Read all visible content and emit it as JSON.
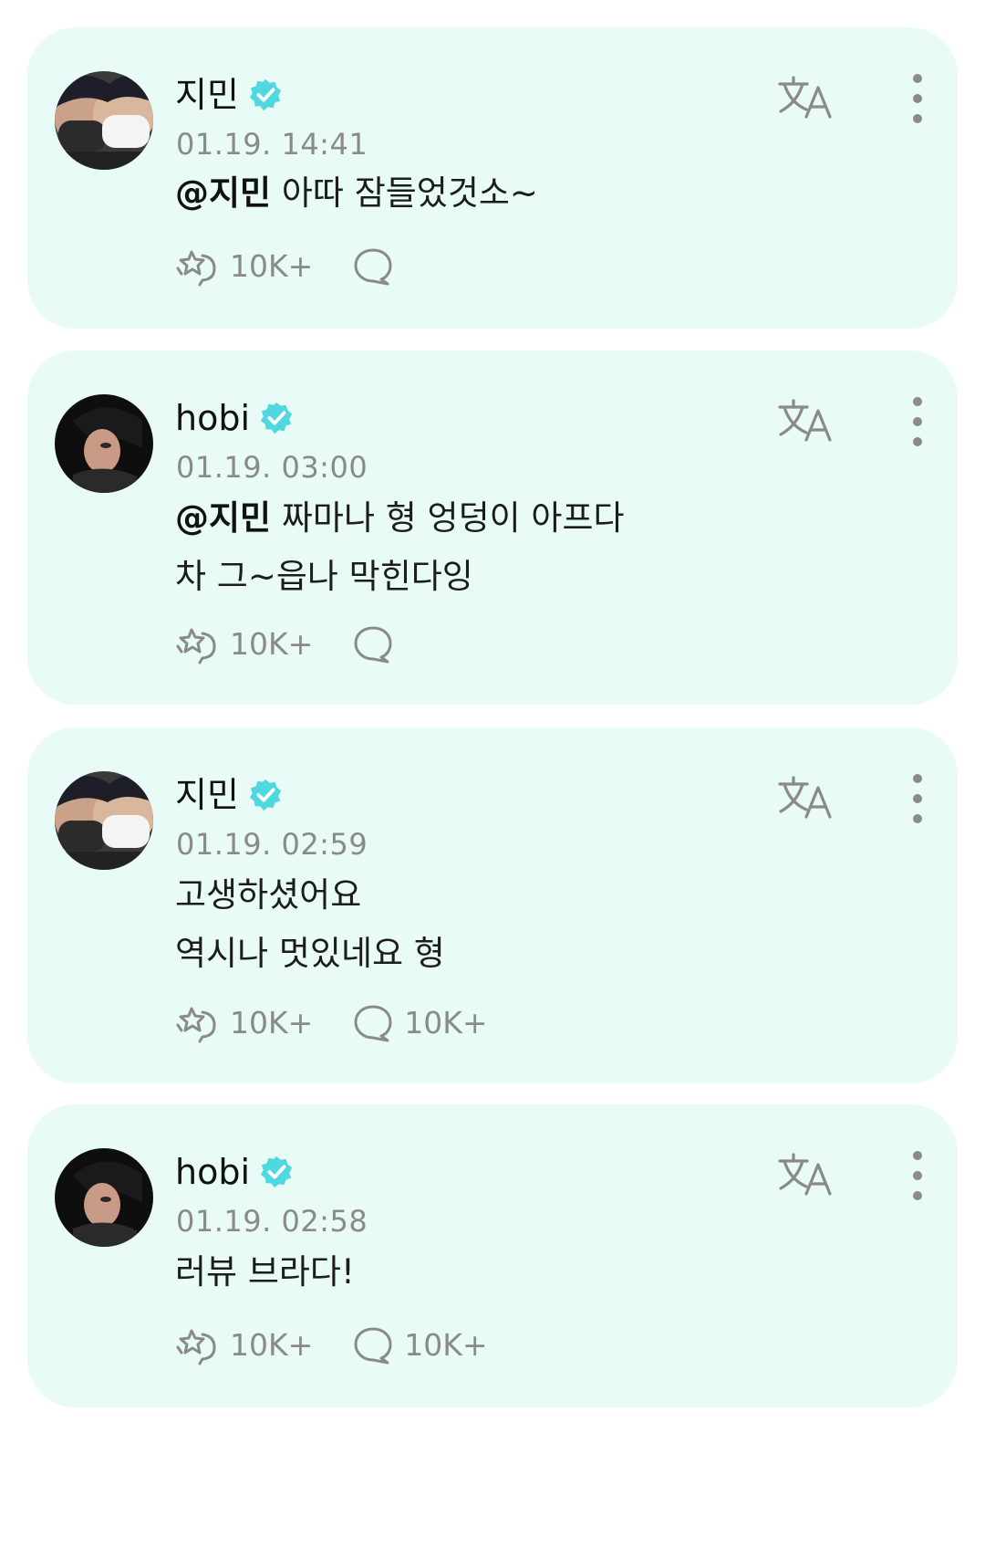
{
  "feed": {
    "posts": [
      {
        "author": "지민",
        "avatar_icon": "avatar-masked-duo-icon",
        "timestamp": "01.19. 14:41",
        "mention": "@지민",
        "lines": [
          "아따 잠들었것소~"
        ],
        "likes": "10K+",
        "comments": ""
      },
      {
        "author": "hobi",
        "avatar_icon": "avatar-hobi-icon",
        "timestamp": "01.19. 03:00",
        "mention": "@지민",
        "lines": [
          "짜마나 형 엉덩이 아프다",
          "차 그~읍나 막힌다잉"
        ],
        "likes": "10K+",
        "comments": ""
      },
      {
        "author": "지민",
        "avatar_icon": "avatar-masked-duo-icon",
        "timestamp": "01.19. 02:59",
        "mention": "",
        "lines": [
          "고생하셨어요",
          "역시나 멋있네요 형"
        ],
        "likes": "10K+",
        "comments": "10K+"
      },
      {
        "author": "hobi",
        "avatar_icon": "avatar-hobi-icon",
        "timestamp": "01.19. 02:58",
        "mention": "",
        "lines": [
          "러뷰 브라다!"
        ],
        "likes": "10K+",
        "comments": "10K+"
      }
    ]
  },
  "colors": {
    "card_background": "#e8fbf6",
    "verified_badge": "#4fd8e0",
    "icon_gray": "#8a8a8a"
  }
}
